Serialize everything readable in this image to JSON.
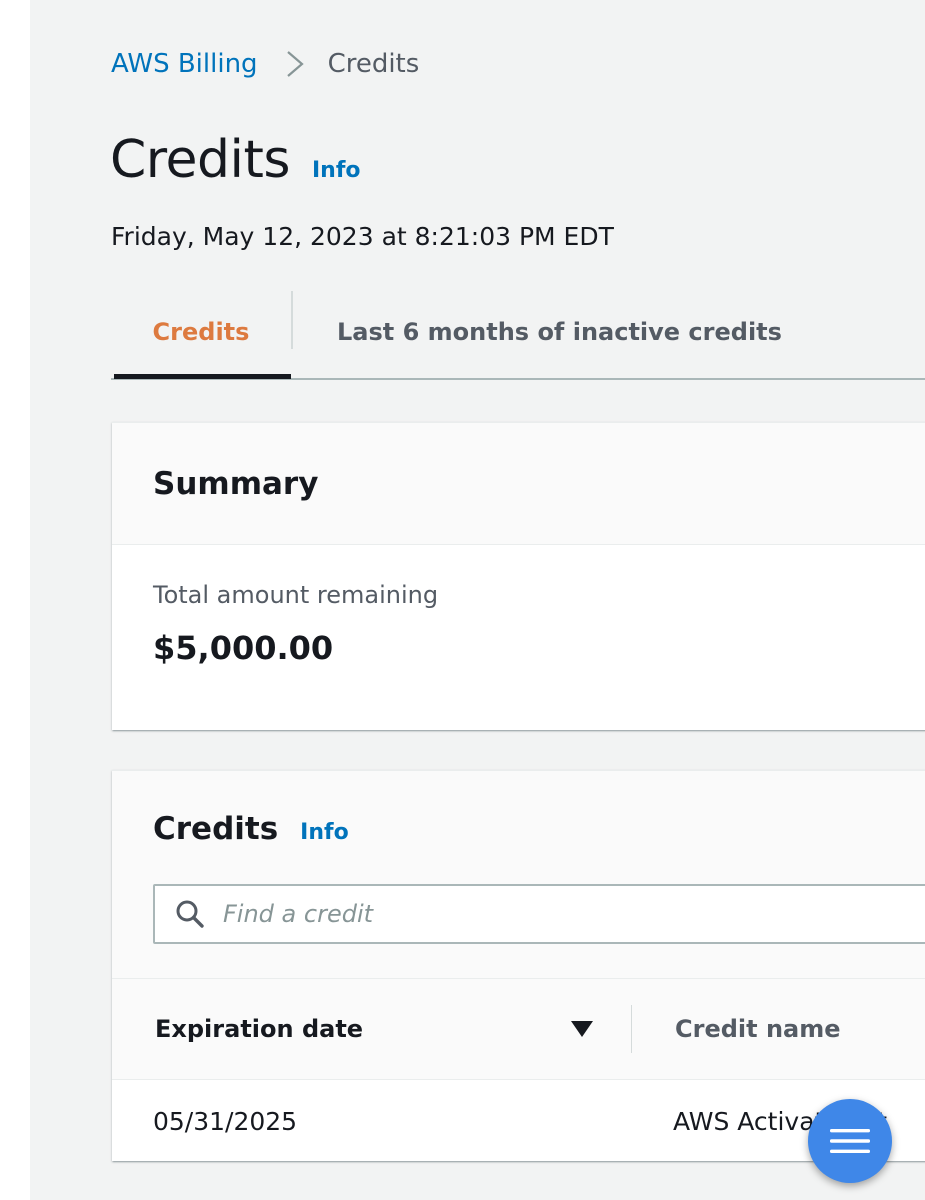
{
  "breadcrumb": {
    "parent": "AWS Billing",
    "current": "Credits"
  },
  "page": {
    "title": "Credits",
    "info_label": "Info",
    "timestamp": "Friday, May 12, 2023 at 8:21:03 PM EDT"
  },
  "tabs": [
    {
      "label": "Credits",
      "active": true
    },
    {
      "label": "Last 6 months of inactive credits",
      "active": false
    }
  ],
  "summary": {
    "title": "Summary",
    "metric_label": "Total amount remaining",
    "metric_value": "$5,000.00"
  },
  "credits_table": {
    "title": "Credits",
    "info_label": "Info",
    "search_placeholder": "Find a credit",
    "columns": [
      "Expiration date",
      "Credit name"
    ],
    "sort": "descending",
    "rows": [
      {
        "expiration_date": "05/31/2025",
        "credit_name": "AWS Activate Pet"
      }
    ]
  },
  "icons": {
    "breadcrumb_separator": "chevron-right-icon",
    "search": "search-icon",
    "sort": "sort-down-icon",
    "menu": "menu-icon"
  },
  "colors": {
    "link": "#0073bb",
    "active_tab": "#dd7a3f",
    "background": "#f2f3f3",
    "fab": "#3f87e8"
  }
}
